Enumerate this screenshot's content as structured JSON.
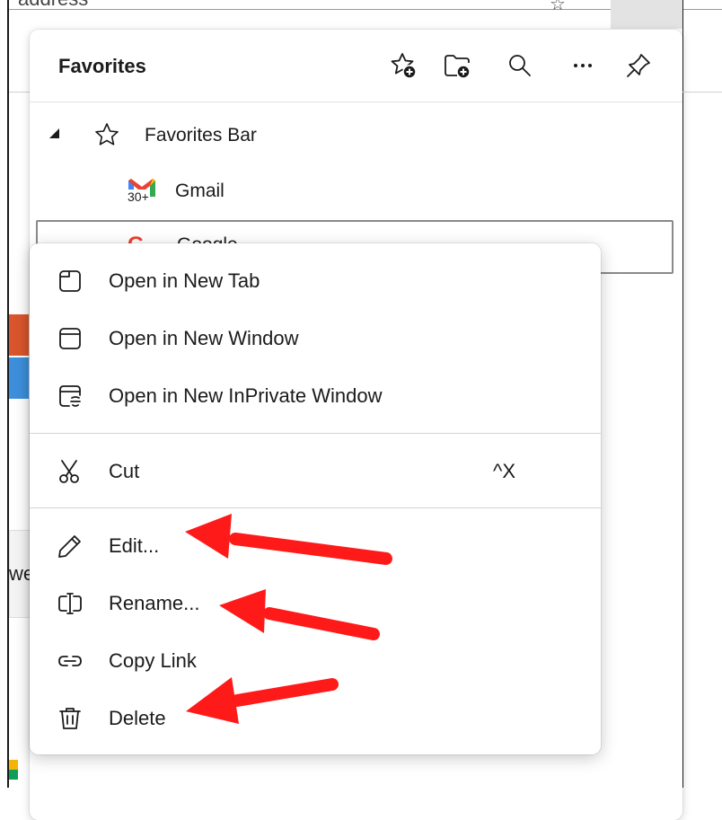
{
  "background": {
    "address_fragment": "address",
    "side_fragment_text": "we"
  },
  "favorites": {
    "title": "Favorites",
    "header_icons": [
      "add-favorite-icon",
      "add-folder-icon",
      "search-icon",
      "more-icon",
      "pin-icon"
    ],
    "tree": [
      {
        "label": "Favorites Bar",
        "icon": "star-icon",
        "expanded": true
      },
      {
        "label": "Gmail",
        "icon": "gmail-icon",
        "badge": "30+"
      },
      {
        "label": "Google",
        "icon": "google-icon"
      }
    ]
  },
  "context_menu": {
    "items": [
      {
        "label": "Open in New Tab",
        "icon": "tab-icon"
      },
      {
        "label": "Open in New Window",
        "icon": "window-icon"
      },
      {
        "label": "Open in New InPrivate Window",
        "icon": "inprivate-window-icon"
      },
      {
        "label": "Cut",
        "icon": "scissors-icon",
        "shortcut": "^X"
      },
      {
        "label": "Edit...",
        "icon": "pencil-icon"
      },
      {
        "label": "Rename...",
        "icon": "rename-icon"
      },
      {
        "label": "Copy Link",
        "icon": "link-icon"
      },
      {
        "label": "Delete",
        "icon": "trash-icon"
      }
    ]
  },
  "annotation_color": "#ff1a1a"
}
